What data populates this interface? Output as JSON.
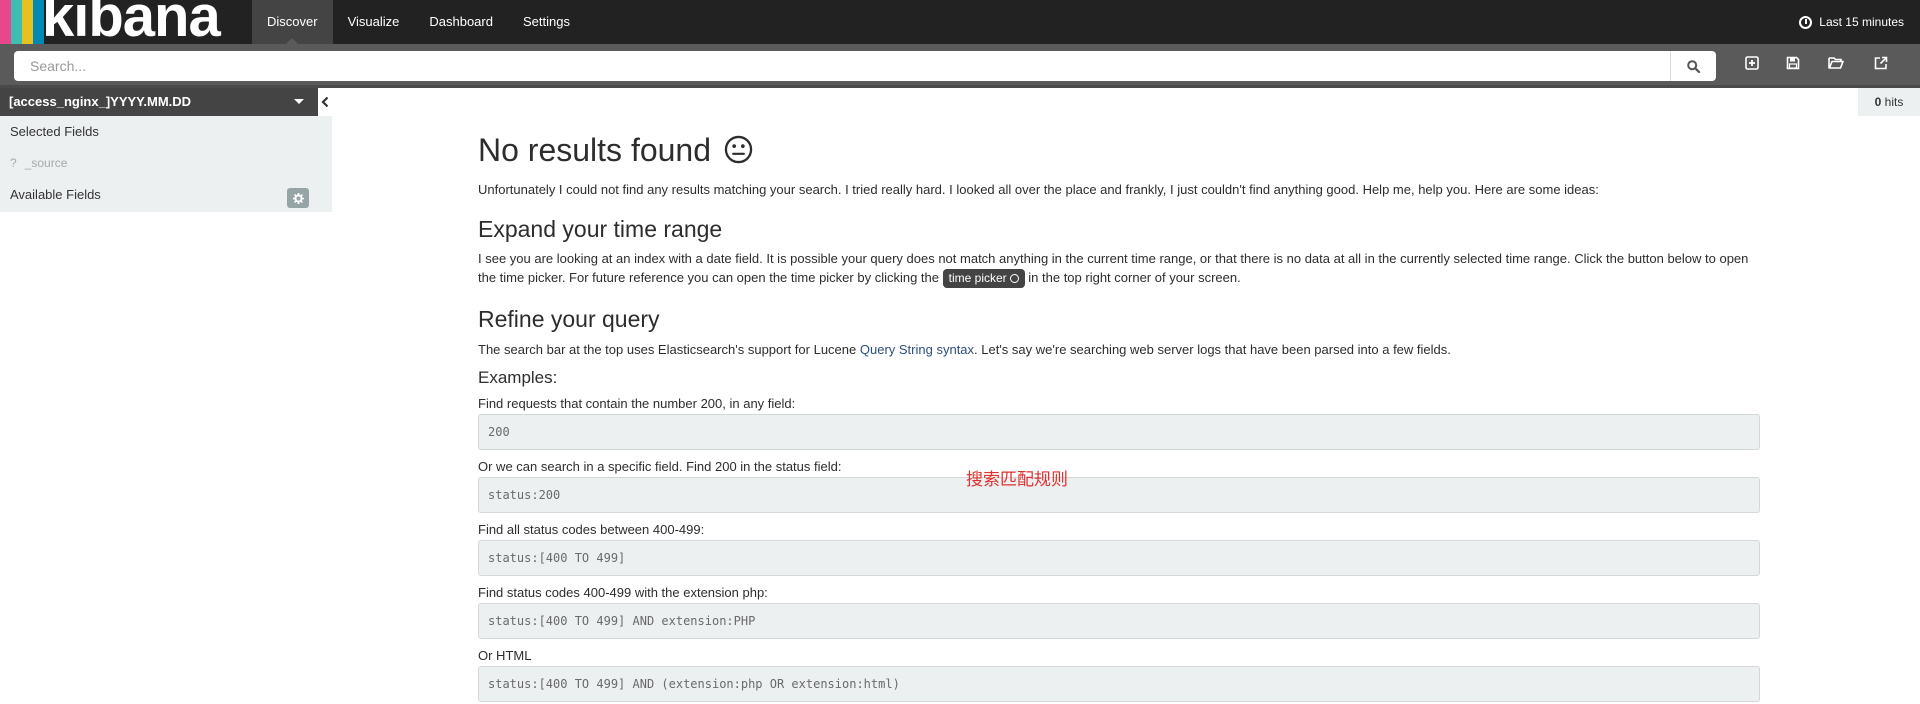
{
  "brand": {
    "name": "kibana",
    "bar_colors": [
      "#e8488b",
      "#3ebeb0",
      "#e6c220",
      "#0089b5",
      "#9170b8"
    ]
  },
  "nav": {
    "tabs": [
      {
        "label": "Discover",
        "active": true
      },
      {
        "label": "Visualize",
        "active": false
      },
      {
        "label": "Dashboard",
        "active": false
      },
      {
        "label": "Settings",
        "active": false
      }
    ],
    "time_range_label": "Last 15 minutes"
  },
  "search": {
    "placeholder": "Search...",
    "value": ""
  },
  "toolbar": {
    "icons": [
      "new-search-icon",
      "save-search-icon",
      "open-search-icon",
      "share-icon"
    ]
  },
  "sidebar": {
    "index_pattern": "[access_nginx_]YYYY.MM.DD",
    "selected_fields_label": "Selected Fields",
    "selected_fields": [
      {
        "type_glyph": "?",
        "name": "_source"
      }
    ],
    "available_fields_label": "Available Fields"
  },
  "hits": {
    "count": "0",
    "label": "hits"
  },
  "content": {
    "title": "No results found",
    "intro": "Unfortunately I could not find any results matching your search. I tried really hard. I looked all over the place and frankly, I just couldn't find anything good. Help me, help you. Here are some ideas:",
    "time_heading": "Expand your time range",
    "time_para_1": "I see you are looking at an index with a date field. It is possible your query does not match anything in the current time range, or that there is no data at all in the currently selected time range. Click the button below to open the time picker. For future reference you can open the time picker by clicking the",
    "time_picker_badge": "time picker",
    "time_para_2": "in the top right corner of your screen.",
    "query_heading": "Refine your query",
    "query_para_1": "The search bar at the top uses Elasticsearch's support for Lucene",
    "query_link": "Query String syntax",
    "query_para_2": ". Let's say we're searching web server logs that have been parsed into a few fields.",
    "examples_heading": "Examples:",
    "examples": [
      {
        "label": "Find requests that contain the number 200, in any field:",
        "query": "200"
      },
      {
        "label": "Or we can search in a specific field. Find 200 in the status field:",
        "query": "status:200"
      },
      {
        "label": "Find all status codes between 400-499:",
        "query": "status:[400 TO 499]"
      },
      {
        "label": "Find status codes 400-499 with the extension php:",
        "query": "status:[400 TO 499] AND extension:PHP"
      },
      {
        "label": "Or HTML",
        "query": "status:[400 TO 499] AND (extension:php OR extension:html)"
      }
    ]
  },
  "annotation": {
    "text": "搜索匹配规则",
    "color": "#e03030"
  }
}
